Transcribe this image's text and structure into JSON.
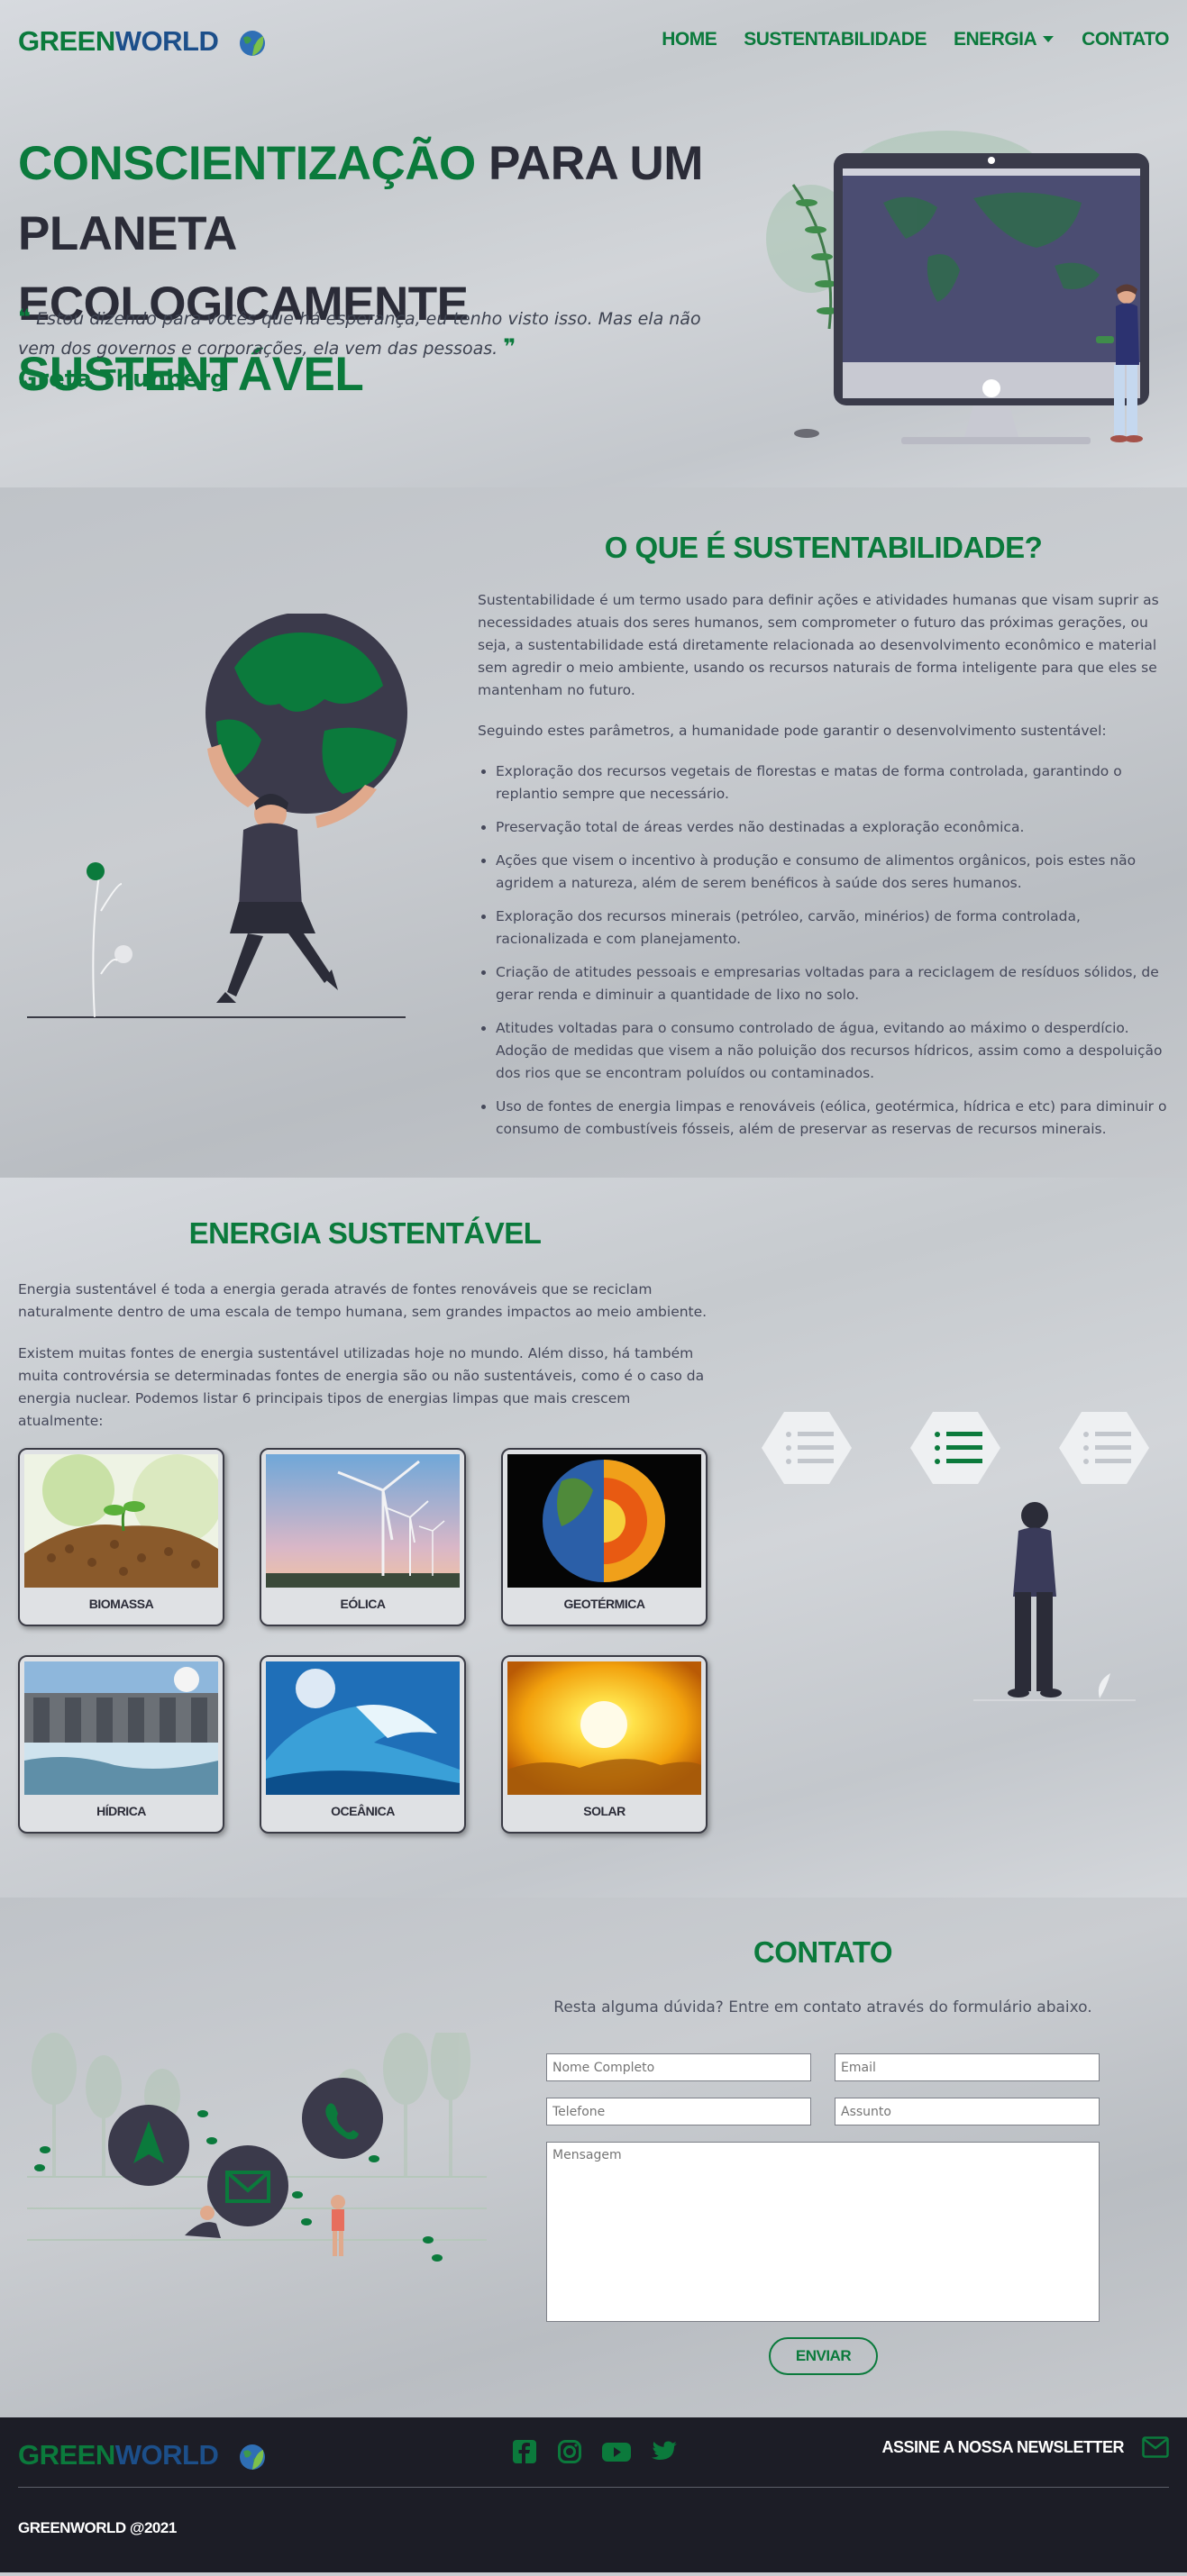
{
  "brand": {
    "part1": "GREEN",
    "part2": "WORLD"
  },
  "nav": {
    "home": "HOME",
    "sust": "SUSTENTABILIDADE",
    "energia": "ENERGIA",
    "contato": "CONTATO"
  },
  "hero": {
    "title_g1": "CONSCIENTIZAÇÃO",
    "title_d1": " PARA UM PLANETA",
    "title_d2": "ECOLOGICAMENTE ",
    "title_g2": "SUSTENTÁVEL",
    "quote": "Estou dizendo para vocês que há esperança, eu tenho visto isso. Mas ela não vem dos governos e corporações, ela vem das pessoas.",
    "author": "Greta Thunberg"
  },
  "sust": {
    "title": "O QUE É SUSTENTABILIDADE?",
    "p1": "Sustentabilidade é um termo usado para definir ações e atividades humanas que visam suprir as necessidades atuais dos seres humanos, sem comprometer o futuro das próximas gerações, ou seja, a sustentabilidade está diretamente relacionada ao desenvolvimento econômico e material sem agredir o meio ambiente, usando os recursos naturais de forma inteligente para que eles se mantenham no futuro.",
    "p2": "Seguindo estes parâmetros, a humanidade pode garantir o desenvolvimento sustentável:",
    "items": [
      "Exploração dos recursos vegetais de florestas e matas de forma controlada, garantindo o replantio sempre que necessário.",
      "Preservação total de áreas verdes não destinadas a exploração econômica.",
      "Ações que visem o incentivo à produção e consumo de alimentos orgânicos, pois estes não agridem a natureza, além de serem benéficos à saúde dos seres humanos.",
      "Exploração dos recursos minerais (petróleo, carvão, minérios) de forma controlada, racionalizada e com planejamento.",
      "Criação de atitudes pessoais e empresarias voltadas para a reciclagem de resíduos sólidos, de gerar renda e diminuir a quantidade de lixo no solo.",
      "Atitudes voltadas para o consumo controlado de água, evitando ao máximo o desperdício. Adoção de medidas que visem a não poluição dos recursos hídricos, assim como a despoluição dos rios que se encontram poluídos ou contaminados.",
      "Uso de fontes de energia limpas e renováveis (eólica, geotérmica, hídrica e etc) para diminuir o consumo de combustíveis fósseis, além de preservar as reservas de recursos minerais."
    ]
  },
  "energia": {
    "title": "ENERGIA SUSTENTÁVEL",
    "p1": "Energia sustentável é toda a energia gerada através de fontes renováveis que se reciclam naturalmente dentro de uma escala de tempo humana, sem grandes impactos ao meio ambiente.",
    "p2": "Existem muitas fontes de energia sustentável utilizadas hoje no mundo. Além disso, há também muita controvérsia se determinadas fontes de energia são ou não sustentáveis, como é o caso da energia nuclear. Podemos listar 6 principais tipos de energias limpas que mais crescem atualmente:",
    "cards": [
      "BIOMASSA",
      "EÓLICA",
      "GEOTÉRMICA",
      "HÍDRICA",
      "OCEÂNICA",
      "SOLAR"
    ]
  },
  "contato": {
    "title": "CONTATO",
    "sub": "Resta alguma dúvida? Entre em contato através do formulário abaixo.",
    "nome": "Nome Completo",
    "email": "Email",
    "tel": "Telefone",
    "assunto": "Assunto",
    "msg": "Mensagem",
    "btn": "ENVIAR"
  },
  "footer": {
    "news": "ASSINE A NOSSA NEWSLETTER",
    "copy": "GREENWORLD @2021"
  },
  "colors": {
    "green": "#0b7a3c",
    "blue": "#1c4f8a",
    "dark": "#2b2c38",
    "footer": "#1c1d26"
  }
}
